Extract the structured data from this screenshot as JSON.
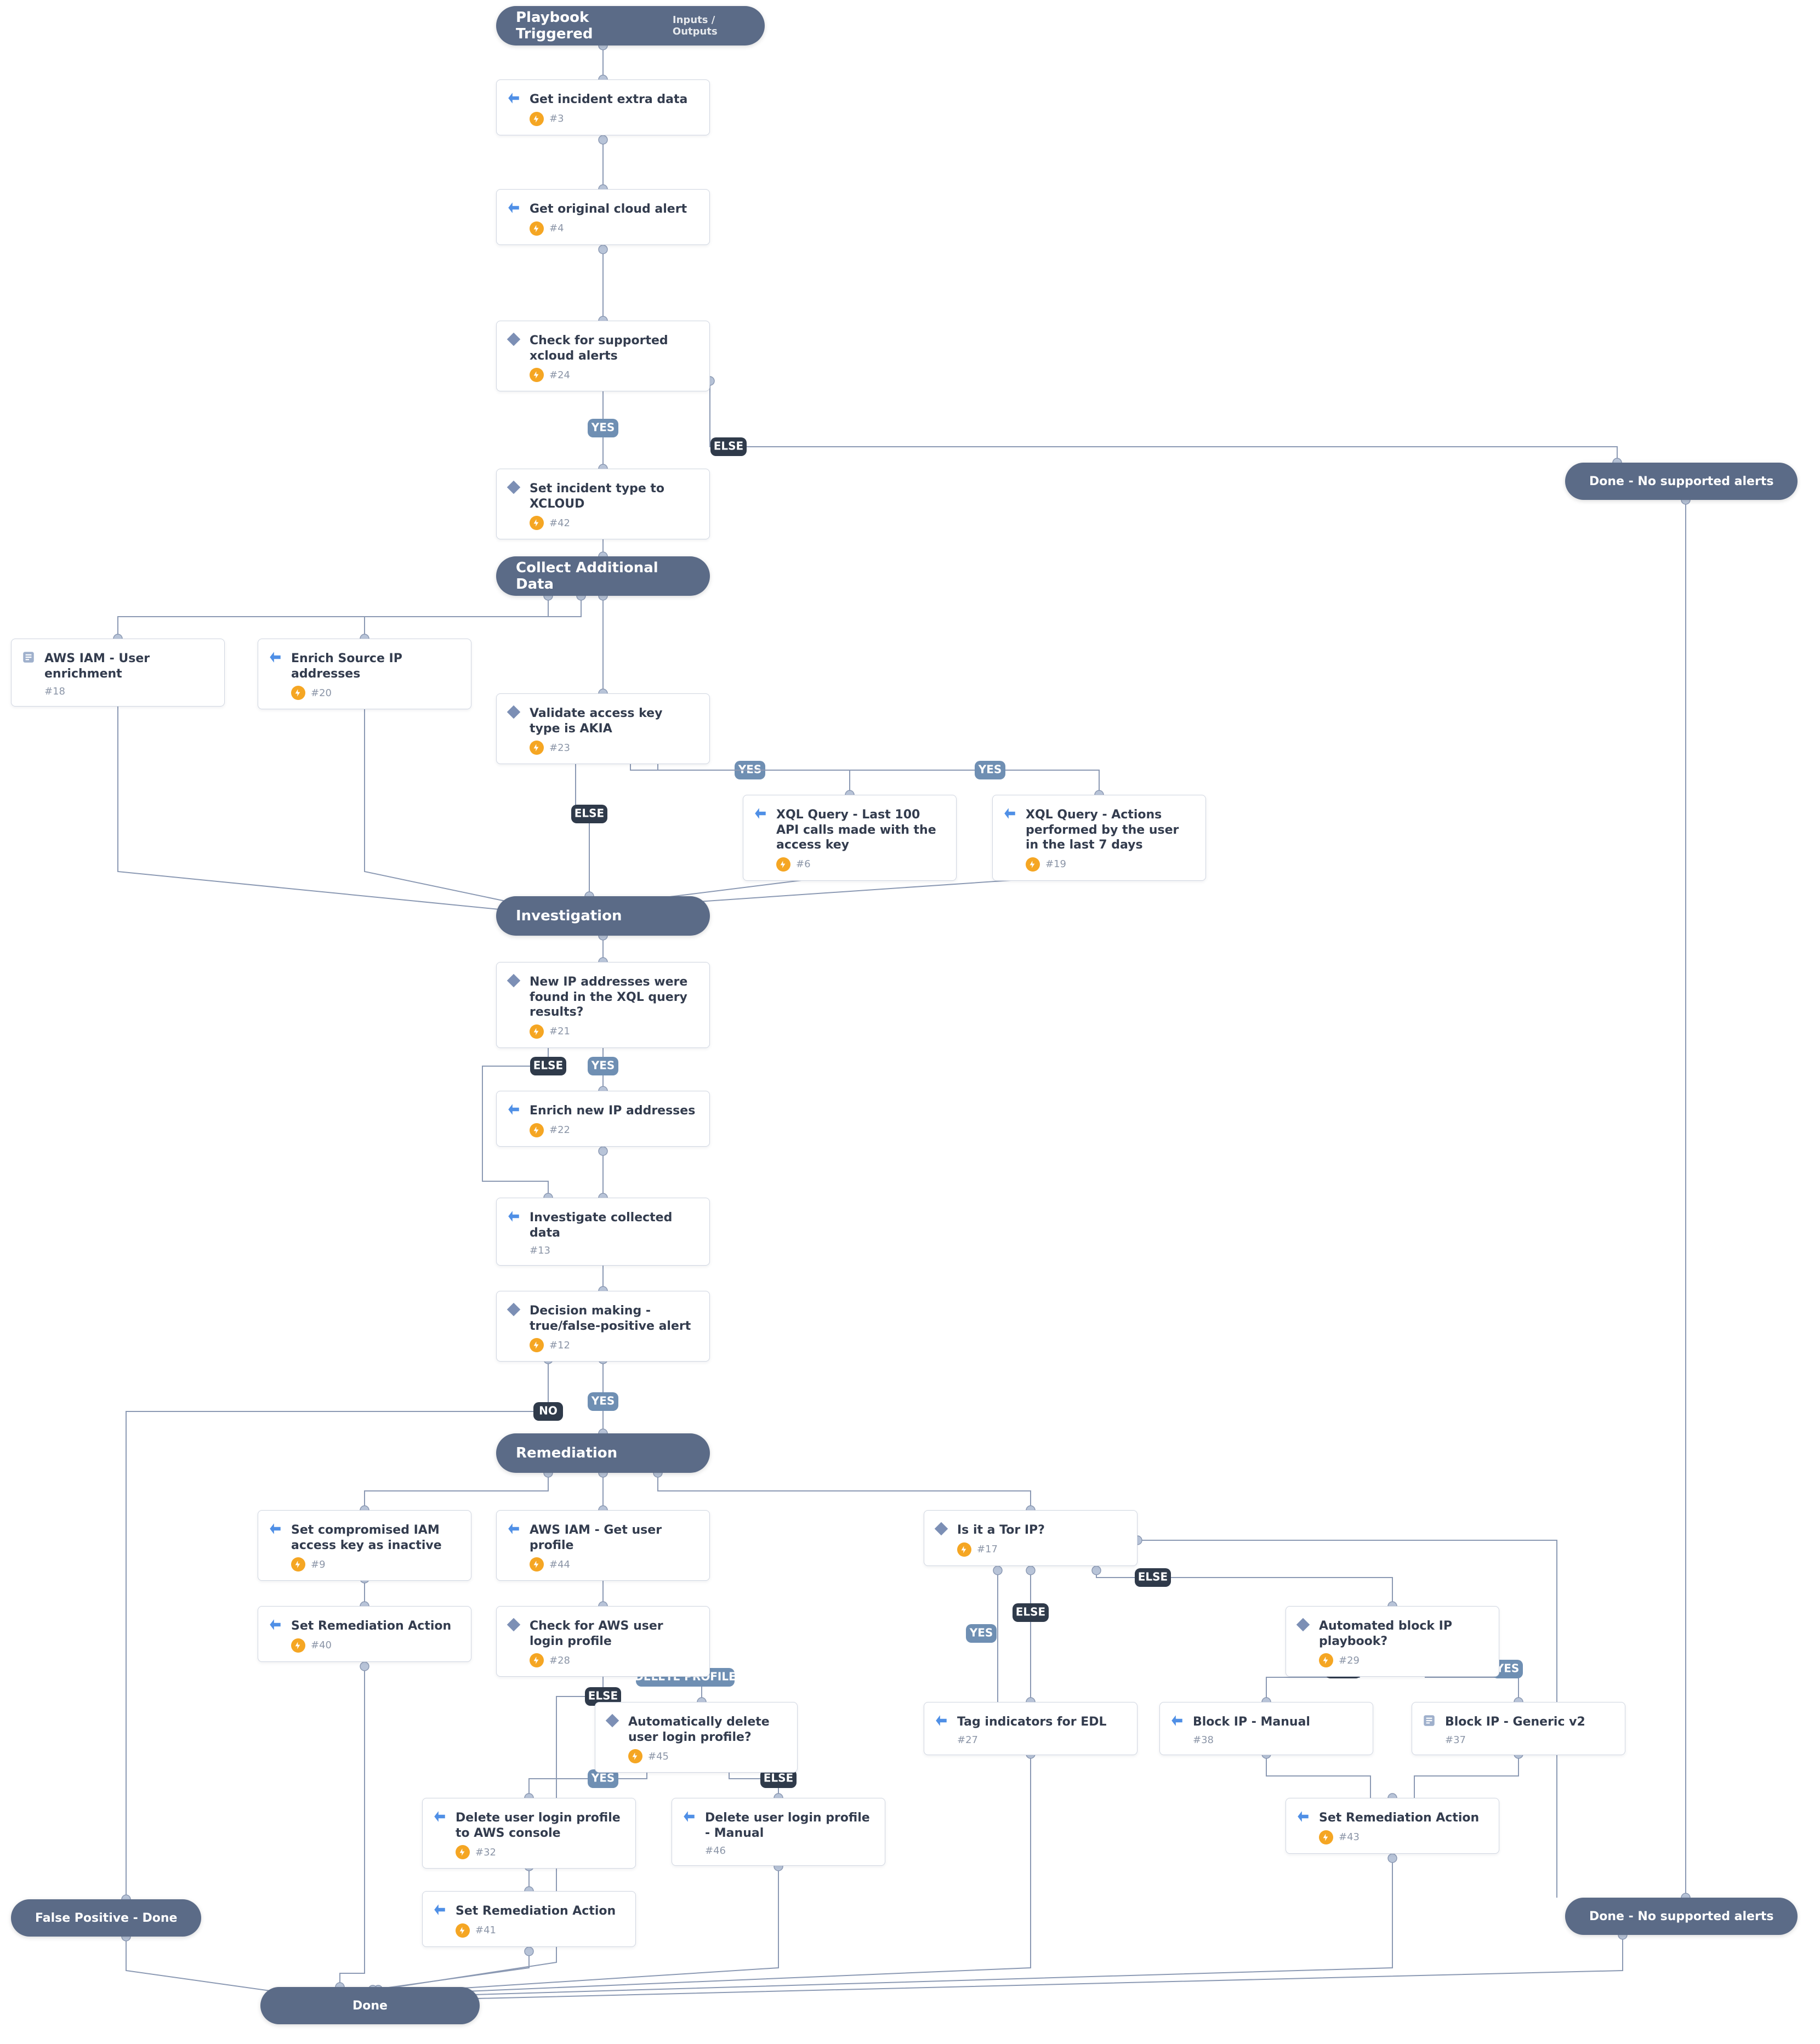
{
  "colors": {
    "section_bg": "#5b6b87",
    "card_border": "#d0d6e1",
    "edge": "#8b99b3",
    "bolt_bg": "#f5a623",
    "label_yes_bg": "#6f8fb3",
    "label_else_bg": "#2f3a4a",
    "label_no_bg": "#2f3a4a",
    "label_delete_bg": "#6f8fb3"
  },
  "sections": {
    "trigger": {
      "title": "Playbook Triggered",
      "sub": "Inputs / Outputs"
    },
    "collect": {
      "title": "Collect Additional Data"
    },
    "investigate": {
      "title": "Investigation"
    },
    "remediate": {
      "title": "Remediation"
    }
  },
  "terminals": {
    "done_no_support_top": "Done - No supported alerts",
    "done_no_support_bottom": "Done - No supported alerts",
    "false_positive_done": "False Positive - Done",
    "done": "Done"
  },
  "tasks": {
    "t3": {
      "title": "Get incident extra data",
      "id": "#3",
      "type": "task"
    },
    "t4": {
      "title": "Get original cloud alert",
      "id": "#4",
      "type": "task"
    },
    "t24": {
      "title": "Check for supported xcloud alerts",
      "id": "#24",
      "type": "cond"
    },
    "t42": {
      "title": "Set incident type to XCLOUD",
      "id": "#42",
      "type": "cond"
    },
    "t18": {
      "title": "AWS IAM - User enrichment",
      "id": "#18",
      "type": "play"
    },
    "t20": {
      "title": "Enrich Source IP addresses",
      "id": "#20",
      "type": "task"
    },
    "t23": {
      "title": "Validate access key type is AKIA",
      "id": "#23",
      "type": "cond"
    },
    "t6": {
      "title": "XQL Query - Last 100 API calls made with the access key",
      "id": "#6",
      "type": "task"
    },
    "t19": {
      "title": "XQL Query - Actions performed by the user in the last 7 days",
      "id": "#19",
      "type": "task"
    },
    "t21": {
      "title": "New IP addresses were found in the XQL query results?",
      "id": "#21",
      "type": "cond"
    },
    "t22": {
      "title": "Enrich new IP addresses",
      "id": "#22",
      "type": "task"
    },
    "t13": {
      "title": "Investigate collected data",
      "id": "#13",
      "type": "task"
    },
    "t12": {
      "title": "Decision making - true/false-positive alert",
      "id": "#12",
      "type": "cond"
    },
    "t9": {
      "title": "Set compromised IAM access key as inactive",
      "id": "#9",
      "type": "task"
    },
    "t40": {
      "title": "Set Remediation Action",
      "id": "#40",
      "type": "task"
    },
    "t44": {
      "title": "AWS IAM - Get user profile",
      "id": "#44",
      "type": "task"
    },
    "t28": {
      "title": "Check for AWS user login profile",
      "id": "#28",
      "type": "cond"
    },
    "t45": {
      "title": "Automatically delete user login profile?",
      "id": "#45",
      "type": "cond"
    },
    "t32": {
      "title": "Delete user login profile to AWS console",
      "id": "#32",
      "type": "task"
    },
    "t46": {
      "title": "Delete user login profile - Manual",
      "id": "#46",
      "type": "task"
    },
    "t41": {
      "title": "Set Remediation Action",
      "id": "#41",
      "type": "task"
    },
    "t17": {
      "title": "Is it a Tor IP?",
      "id": "#17",
      "type": "cond"
    },
    "t27": {
      "title": "Tag indicators for EDL",
      "id": "#27",
      "type": "task"
    },
    "t29": {
      "title": "Automated block IP playbook?",
      "id": "#29",
      "type": "cond"
    },
    "t38": {
      "title": "Block IP - Manual",
      "id": "#38",
      "type": "task"
    },
    "t37": {
      "title": "Block IP - Generic v2",
      "id": "#37",
      "type": "play"
    },
    "t43": {
      "title": "Set Remediation Action",
      "id": "#43",
      "type": "task"
    }
  },
  "edge_labels": {
    "yes": "YES",
    "else": "ELSE",
    "no": "NO",
    "delete_profile": "DELETE PROFILE"
  },
  "chart_data": {
    "type": "flowchart",
    "title": "Playbook Triggered",
    "nodes": [
      {
        "id": "trigger",
        "type": "section",
        "label": "Playbook Triggered",
        "sub": "Inputs / Outputs"
      },
      {
        "id": "t3",
        "type": "task",
        "label": "Get incident extra data",
        "task_id": "#3"
      },
      {
        "id": "t4",
        "type": "task",
        "label": "Get original cloud alert",
        "task_id": "#4"
      },
      {
        "id": "t24",
        "type": "condition",
        "label": "Check for supported xcloud alerts",
        "task_id": "#24"
      },
      {
        "id": "t42",
        "type": "condition",
        "label": "Set incident type to XCLOUD",
        "task_id": "#42"
      },
      {
        "id": "done_ns_top",
        "type": "terminal",
        "label": "Done - No supported alerts"
      },
      {
        "id": "collect",
        "type": "section",
        "label": "Collect Additional Data"
      },
      {
        "id": "t18",
        "type": "playbook",
        "label": "AWS IAM - User enrichment",
        "task_id": "#18"
      },
      {
        "id": "t20",
        "type": "task",
        "label": "Enrich Source IP addresses",
        "task_id": "#20"
      },
      {
        "id": "t23",
        "type": "condition",
        "label": "Validate access key type is AKIA",
        "task_id": "#23"
      },
      {
        "id": "t6",
        "type": "task",
        "label": "XQL Query - Last 100 API calls made with the access key",
        "task_id": "#6"
      },
      {
        "id": "t19",
        "type": "task",
        "label": "XQL Query - Actions performed by the user in the last 7 days",
        "task_id": "#19"
      },
      {
        "id": "investigate",
        "type": "section",
        "label": "Investigation"
      },
      {
        "id": "t21",
        "type": "condition",
        "label": "New IP addresses were found in the XQL query results?",
        "task_id": "#21"
      },
      {
        "id": "t22",
        "type": "task",
        "label": "Enrich new IP addresses",
        "task_id": "#22"
      },
      {
        "id": "t13",
        "type": "task",
        "label": "Investigate collected data",
        "task_id": "#13"
      },
      {
        "id": "t12",
        "type": "condition",
        "label": "Decision making - true/false-positive alert",
        "task_id": "#12"
      },
      {
        "id": "remediate",
        "type": "section",
        "label": "Remediation"
      },
      {
        "id": "t9",
        "type": "task",
        "label": "Set compromised IAM access key as inactive",
        "task_id": "#9"
      },
      {
        "id": "t40",
        "type": "task",
        "label": "Set Remediation Action",
        "task_id": "#40"
      },
      {
        "id": "t44",
        "type": "task",
        "label": "AWS IAM - Get user profile",
        "task_id": "#44"
      },
      {
        "id": "t28",
        "type": "condition",
        "label": "Check for AWS user login profile",
        "task_id": "#28"
      },
      {
        "id": "t45",
        "type": "condition",
        "label": "Automatically delete user login profile?",
        "task_id": "#45"
      },
      {
        "id": "t32",
        "type": "task",
        "label": "Delete user login profile to AWS console",
        "task_id": "#32"
      },
      {
        "id": "t46",
        "type": "task",
        "label": "Delete user login profile - Manual",
        "task_id": "#46"
      },
      {
        "id": "t41",
        "type": "task",
        "label": "Set Remediation Action",
        "task_id": "#41"
      },
      {
        "id": "t17",
        "type": "condition",
        "label": "Is it a Tor IP?",
        "task_id": "#17"
      },
      {
        "id": "t27",
        "type": "task",
        "label": "Tag indicators for EDL",
        "task_id": "#27"
      },
      {
        "id": "t29",
        "type": "condition",
        "label": "Automated block IP playbook?",
        "task_id": "#29"
      },
      {
        "id": "t38",
        "type": "task",
        "label": "Block IP - Manual",
        "task_id": "#38"
      },
      {
        "id": "t37",
        "type": "playbook",
        "label": "Block IP - Generic v2",
        "task_id": "#37"
      },
      {
        "id": "t43",
        "type": "task",
        "label": "Set Remediation Action",
        "task_id": "#43"
      },
      {
        "id": "fp_done",
        "type": "terminal",
        "label": "False Positive - Done"
      },
      {
        "id": "done_ns_bottom",
        "type": "terminal",
        "label": "Done - No supported alerts"
      },
      {
        "id": "done",
        "type": "terminal",
        "label": "Done"
      }
    ],
    "edges": [
      {
        "from": "trigger",
        "to": "t3"
      },
      {
        "from": "t3",
        "to": "t4"
      },
      {
        "from": "t4",
        "to": "t24"
      },
      {
        "from": "t24",
        "to": "t42",
        "label": "YES"
      },
      {
        "from": "t24",
        "to": "done_ns_top",
        "label": "ELSE"
      },
      {
        "from": "t42",
        "to": "collect"
      },
      {
        "from": "collect",
        "to": "t18"
      },
      {
        "from": "collect",
        "to": "t20"
      },
      {
        "from": "collect",
        "to": "t23"
      },
      {
        "from": "t23",
        "to": "t6",
        "label": "YES"
      },
      {
        "from": "t23",
        "to": "t19",
        "label": "YES"
      },
      {
        "from": "t23",
        "to": "investigate",
        "label": "ELSE"
      },
      {
        "from": "t18",
        "to": "investigate"
      },
      {
        "from": "t20",
        "to": "investigate"
      },
      {
        "from": "t6",
        "to": "investigate"
      },
      {
        "from": "t19",
        "to": "investigate"
      },
      {
        "from": "investigate",
        "to": "t21"
      },
      {
        "from": "t21",
        "to": "t22",
        "label": "YES"
      },
      {
        "from": "t21",
        "to": "t13",
        "label": "ELSE"
      },
      {
        "from": "t22",
        "to": "t13"
      },
      {
        "from": "t13",
        "to": "t12"
      },
      {
        "from": "t12",
        "to": "remediate",
        "label": "YES"
      },
      {
        "from": "t12",
        "to": "fp_done",
        "label": "NO"
      },
      {
        "from": "remediate",
        "to": "t9"
      },
      {
        "from": "remediate",
        "to": "t44"
      },
      {
        "from": "remediate",
        "to": "t17"
      },
      {
        "from": "t9",
        "to": "t40"
      },
      {
        "from": "t40",
        "to": "done"
      },
      {
        "from": "t44",
        "to": "t28"
      },
      {
        "from": "t28",
        "to": "t45",
        "label": "DELETE PROFILE"
      },
      {
        "from": "t28",
        "to": "done",
        "label": "ELSE"
      },
      {
        "from": "t45",
        "to": "t32",
        "label": "YES"
      },
      {
        "from": "t45",
        "to": "t46",
        "label": "ELSE"
      },
      {
        "from": "t32",
        "to": "t41"
      },
      {
        "from": "t46",
        "to": "done"
      },
      {
        "from": "t41",
        "to": "done"
      },
      {
        "from": "t17",
        "to": "t27",
        "label": "YES"
      },
      {
        "from": "t17",
        "to": "t29",
        "label": "ELSE"
      },
      {
        "from": "t17",
        "to": "done_ns_bottom",
        "label": "ELSE"
      },
      {
        "from": "t29",
        "to": "t38",
        "label": "ELSE"
      },
      {
        "from": "t29",
        "to": "t37",
        "label": "YES"
      },
      {
        "from": "t38",
        "to": "t43"
      },
      {
        "from": "t37",
        "to": "t43"
      },
      {
        "from": "t27",
        "to": "done"
      },
      {
        "from": "t43",
        "to": "done"
      },
      {
        "from": "done_ns_top",
        "to": "done_ns_bottom"
      },
      {
        "from": "done_ns_bottom",
        "to": "done"
      },
      {
        "from": "fp_done",
        "to": "done"
      }
    ]
  }
}
